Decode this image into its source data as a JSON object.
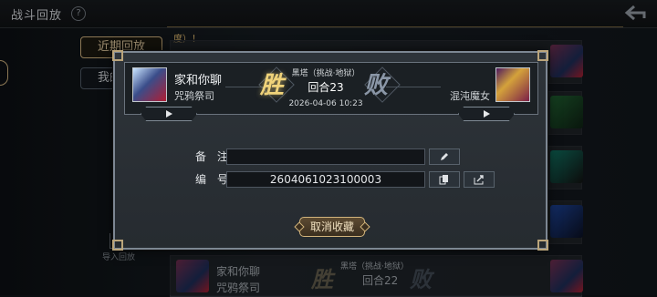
{
  "header": {
    "title": "战斗回放",
    "help": "?"
  },
  "sidebar": {
    "tabs": [
      {
        "label": "近期回放"
      },
      {
        "label": "我的收藏"
      }
    ],
    "import_label": "导入回放"
  },
  "notice_text": "度）！",
  "background_rows": [
    {
      "mode": "黑塔（挑战·地狱）",
      "round": "回合22",
      "player_name": "家和你聊",
      "player_class": "咒鸦祭司",
      "result_left": "胜",
      "result_right": "败"
    }
  ],
  "modal": {
    "left_player": {
      "name": "家和你聊",
      "class": "咒鸦祭司"
    },
    "right_player": {
      "class": "混沌魔女"
    },
    "result_left": "胜",
    "result_right": "败",
    "mode": "黑塔（挑战·地狱）",
    "round": "回合23",
    "date": "2026-04-06 10:23",
    "note_label": "备 注",
    "note_value": "",
    "id_label": "编 号",
    "id_value": "2604061023100003",
    "cancel_label": "取消收藏"
  },
  "colors": {
    "accent": "#c3a777",
    "win": "#f0d37a",
    "lose": "#8a96a6",
    "panel_border": "#7d8793"
  }
}
